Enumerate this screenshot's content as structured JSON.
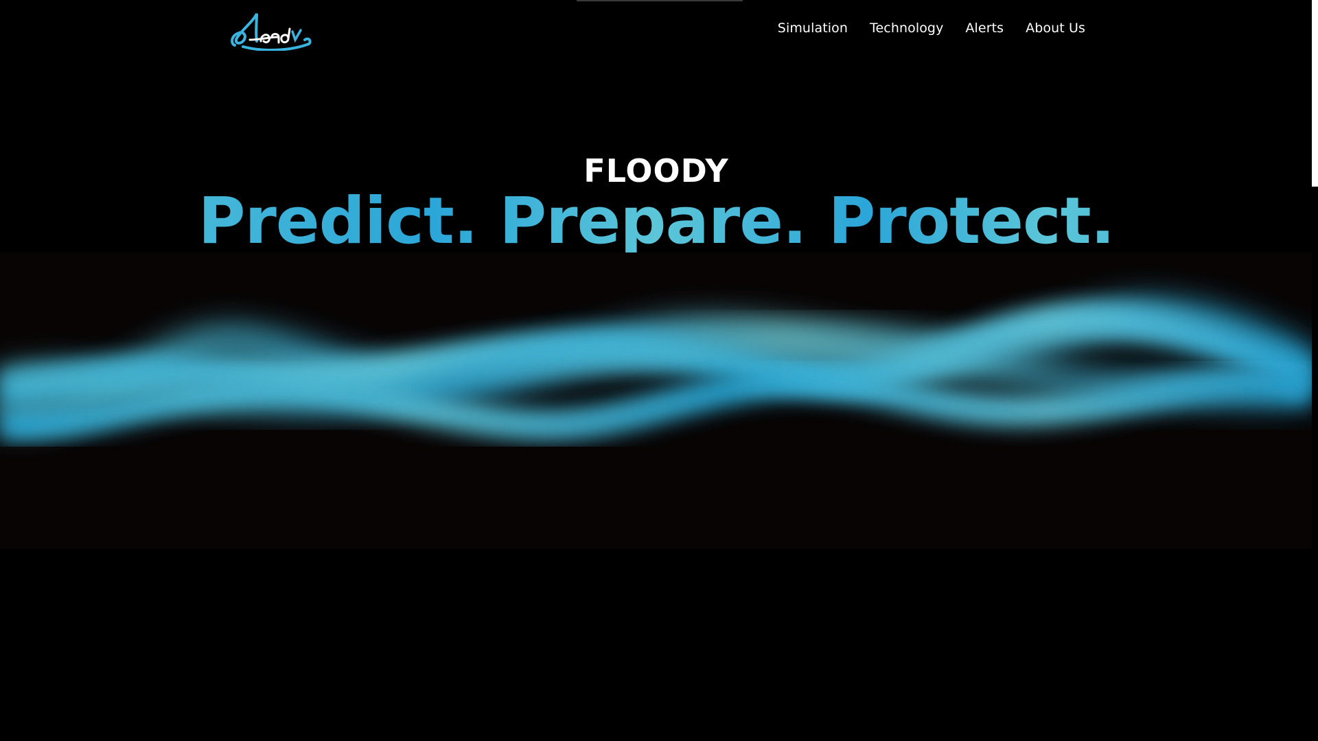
{
  "header": {
    "logo_alt": "Floody",
    "logo_icon": "floody-logo",
    "nav": [
      {
        "label": "Simulation"
      },
      {
        "label": "Technology"
      },
      {
        "label": "Alerts"
      },
      {
        "label": "About Us"
      }
    ]
  },
  "hero": {
    "title": "FLOODY",
    "tagline": "Predict. Prepare. Protect."
  },
  "colors": {
    "background": "#000000",
    "accent_light": "#5cc6d8",
    "accent_dark": "#2ba6d8",
    "wave_band": "#080404"
  }
}
